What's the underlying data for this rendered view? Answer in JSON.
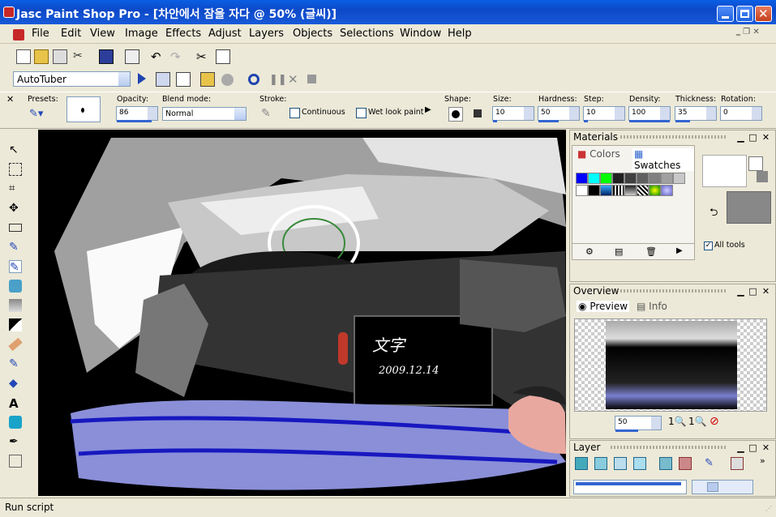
{
  "window": {
    "title": "Jasc Paint Shop Pro - [차안에서 잠을 자다 @  50% (글씨)]"
  },
  "menu": [
    "File",
    "Edit",
    "View",
    "Image",
    "Effects",
    "Adjust",
    "Layers",
    "Objects",
    "Selections",
    "Window",
    "Help"
  ],
  "script_bar": {
    "script_name": "AutoTuber"
  },
  "tool_options": {
    "presets_label": "Presets:",
    "opacity_label": "Opacity:",
    "opacity": "86",
    "blend_label": "Blend mode:",
    "blend_value": "Normal",
    "stroke_label": "Stroke:",
    "continuous_label": "Continuous",
    "wet_look_label": "Wet look paint",
    "shape_label": "Shape:",
    "size_label": "Size:",
    "size": "10",
    "hardness_label": "Hardness:",
    "hardness": "50",
    "step_label": "Step:",
    "step": "10",
    "density_label": "Density:",
    "density": "100",
    "thickness_label": "Thickness:",
    "thickness": "35",
    "rotation_label": "Rotation:",
    "rotation": "0"
  },
  "canvas": {
    "annotation_chars": "文字",
    "annotation_date": "2009.12.14"
  },
  "materials": {
    "title": "Materials",
    "tab_colors": "Colors",
    "tab_swatches": "Swatches",
    "all_tools_label": "All tools"
  },
  "overview": {
    "title": "Overview",
    "tab_preview": "Preview",
    "tab_info": "Info",
    "zoom": "50"
  },
  "layer": {
    "title": "Layer"
  },
  "status": {
    "text": "Run script"
  },
  "colors": {
    "title_bar": "#0d49c9",
    "accent": "#3465d0"
  }
}
